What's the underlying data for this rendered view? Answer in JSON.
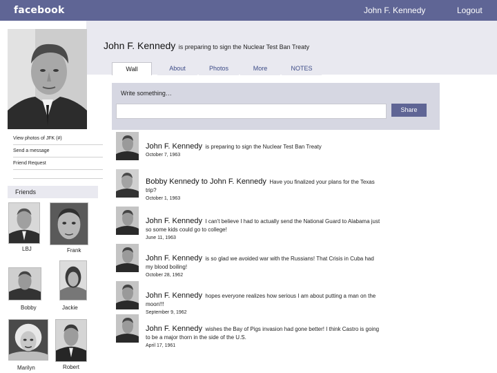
{
  "topbar": {
    "brand": "facebook",
    "user_name": "John F. Kennedy",
    "logout": "Logout"
  },
  "profile": {
    "name": "John F. Kennedy",
    "status": "is preparing to sign the Nuclear Test Ban Treaty"
  },
  "tabs": [
    {
      "label": "Wall",
      "active": true
    },
    {
      "label": "About"
    },
    {
      "label": "Photos"
    },
    {
      "label": "More"
    },
    {
      "label": "NOTES"
    }
  ],
  "composer": {
    "prompt": "Write something…",
    "input_value": "",
    "share_label": "Share"
  },
  "sidebar": {
    "links": [
      "View photos of JFK (#)",
      "Send a message",
      "Friend Request"
    ],
    "friends_title": "Friends"
  },
  "friends": [
    {
      "name": "LBJ"
    },
    {
      "name": "Frank"
    },
    {
      "name": "Bobby"
    },
    {
      "name": "Jackie"
    },
    {
      "name": "Marilyn"
    },
    {
      "name": "Robert"
    }
  ],
  "posts": [
    {
      "author": "John F. Kennedy",
      "text": "is preparing to sign the Nuclear Test Ban Treaty",
      "date": "October 7, 1963"
    },
    {
      "author": "Bobby Kennedy to John F. Kennedy",
      "text": "Have you finalized your plans for the Texas trip?",
      "date": "October 1, 1963"
    },
    {
      "author": "John F. Kennedy",
      "text": "I can't believe I had to actually send the National Guard to Alabama just so some kids could go to college!",
      "date": "June 11, 1963"
    },
    {
      "author": "John F. Kennedy",
      "text": "is so glad we avoided war with the Russians! That Crisis in Cuba had my blood boiling!",
      "date": "October 28, 1962"
    },
    {
      "author": "John F. Kennedy",
      "text": "hopes everyone realizes how serious I am about putting a man on the moon!!!",
      "date": "September 9, 1962"
    },
    {
      "author": "John F. Kennedy",
      "text": "wishes the Bay of Pigs invasion had gone better! I think Castro is going to be a major thorn in the side of the U.S.",
      "date": "April 17, 1961"
    }
  ],
  "colors": {
    "topbar": "#5f6595",
    "header_band": "#e9e9f0",
    "composer": "#d6d7e2",
    "tab_text": "#3b4a86"
  }
}
